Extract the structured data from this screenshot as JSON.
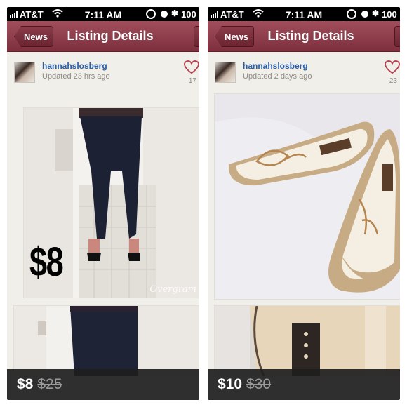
{
  "status_bar": {
    "carrier": "AT&T",
    "time": "7:11 AM",
    "battery": "100"
  },
  "screens": [
    {
      "nav": {
        "back_label": "News",
        "title": "Listing Details"
      },
      "seller": {
        "username": "hannahslosberg",
        "updated": "Updated 23 hrs ago"
      },
      "likes": "17",
      "photo_overlay_price": "$8",
      "watermark": "Overgram",
      "price": "$8",
      "original_price": "$25"
    },
    {
      "nav": {
        "back_label": "News",
        "title": "Listing Details"
      },
      "seller": {
        "username": "hannahslosberg",
        "updated": "Updated 2 days ago"
      },
      "likes": "23",
      "price": "$10",
      "original_price": "$30"
    }
  ],
  "colors": {
    "nav_bar": "#8c3c4a",
    "username": "#2a5ea8",
    "heart": "#b8404f"
  }
}
